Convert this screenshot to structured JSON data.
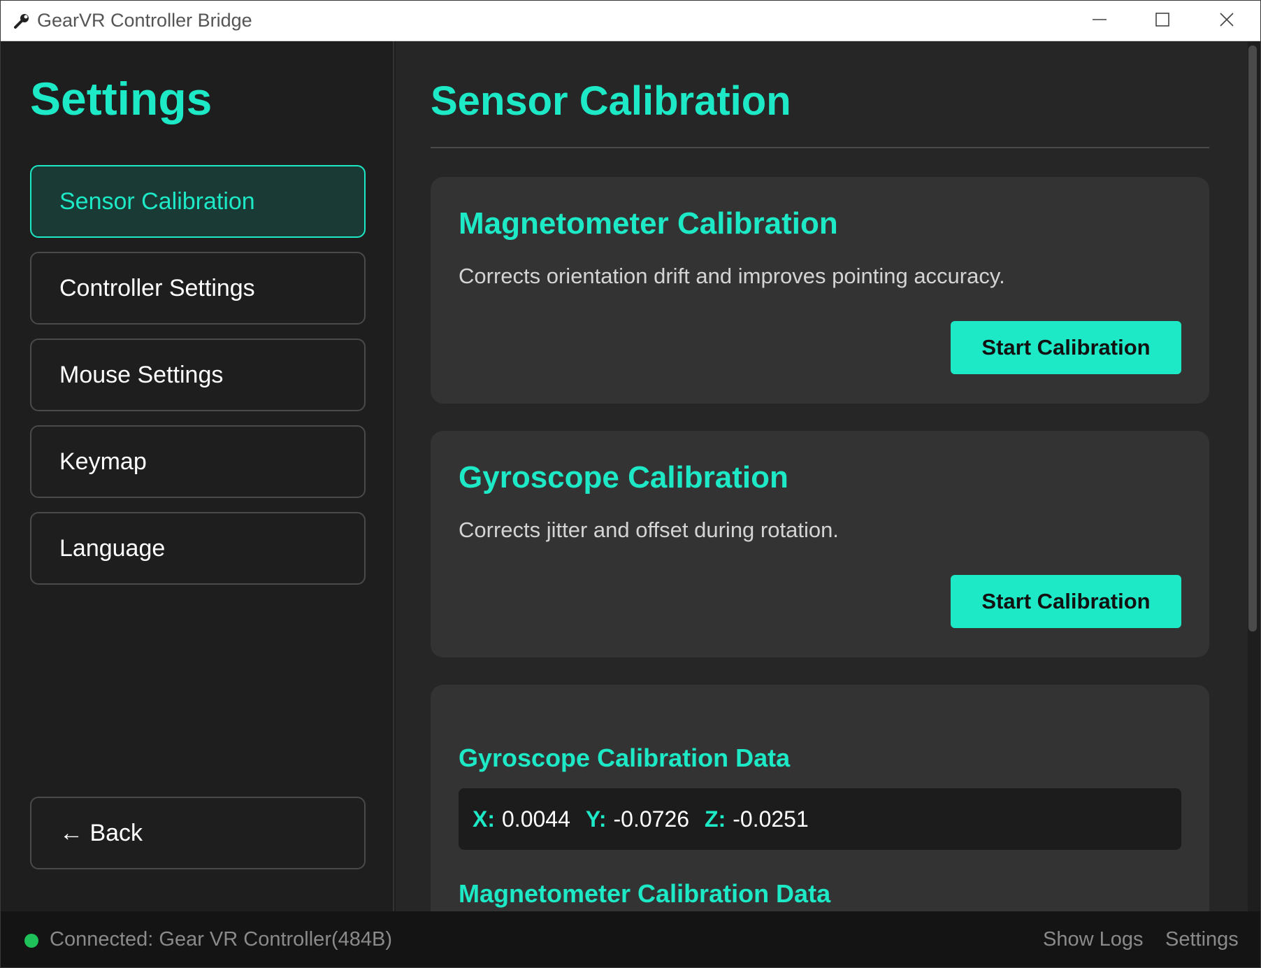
{
  "window": {
    "title": "GearVR Controller Bridge"
  },
  "sidebar": {
    "title": "Settings",
    "items": [
      {
        "label": "Sensor Calibration",
        "active": true
      },
      {
        "label": "Controller Settings",
        "active": false
      },
      {
        "label": "Mouse Settings",
        "active": false
      },
      {
        "label": "Keymap",
        "active": false
      },
      {
        "label": "Language",
        "active": false
      }
    ],
    "back_label": "← Back"
  },
  "main": {
    "title": "Sensor Calibration",
    "cards": [
      {
        "title": "Magnetometer Calibration",
        "description": "Corrects orientation drift and improves pointing accuracy.",
        "button_label": "Start Calibration"
      },
      {
        "title": "Gyroscope Calibration",
        "description": "Corrects jitter and offset during rotation.",
        "button_label": "Start Calibration"
      }
    ],
    "data_card": {
      "gyro_heading": "Gyroscope Calibration Data",
      "gyro": {
        "x_label": "X:",
        "x_value": "0.0044",
        "y_label": "Y:",
        "y_value": "-0.0726",
        "z_label": "Z:",
        "z_value": "-0.0251"
      },
      "mag_heading": "Magnetometer Calibration Data"
    }
  },
  "status": {
    "connection_text": "Connected: Gear VR Controller(484B)",
    "show_logs_label": "Show Logs",
    "settings_label": "Settings"
  },
  "colors": {
    "accent": "#1de9c6",
    "connected": "#1ec15a",
    "background": "#1e1e1e"
  },
  "icons": {
    "app": "wrench-icon",
    "minimize": "minimize-icon",
    "maximize": "maximize-icon",
    "close": "close-icon"
  }
}
